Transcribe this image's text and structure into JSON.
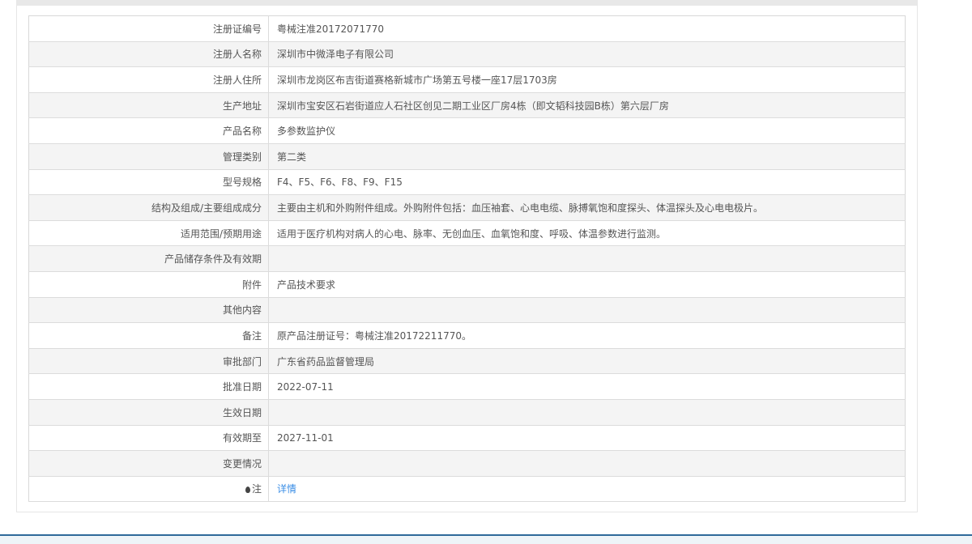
{
  "rows": [
    {
      "label": "注册证编号",
      "value": "粤械注准20172071770"
    },
    {
      "label": "注册人名称",
      "value": "深圳市中微泽电子有限公司"
    },
    {
      "label": "注册人住所",
      "value": "深圳市龙岗区布吉街道赛格新城市广场第五号楼一座17层1703房"
    },
    {
      "label": "生产地址",
      "value": "深圳市宝安区石岩街道应人石社区创见二期工业区厂房4栋（即文韬科技园B栋）第六层厂房"
    },
    {
      "label": "产品名称",
      "value": "多参数监护仪"
    },
    {
      "label": "管理类别",
      "value": "第二类"
    },
    {
      "label": "型号规格",
      "value": "F4、F5、F6、F8、F9、F15"
    },
    {
      "label": "结构及组成/主要组成成分",
      "value": "主要由主机和外购附件组成。外购附件包括：血压袖套、心电电缆、脉搏氧饱和度探头、体温探头及心电电极片。"
    },
    {
      "label": "适用范围/预期用途",
      "value": "适用于医疗机构对病人的心电、脉率、无创血压、血氧饱和度、呼吸、体温参数进行监测。"
    },
    {
      "label": "产品储存条件及有效期",
      "value": ""
    },
    {
      "label": "附件",
      "value": "产品技术要求"
    },
    {
      "label": "其他内容",
      "value": ""
    },
    {
      "label": "备注",
      "value": "原产品注册证号：粤械注准20172211770。"
    },
    {
      "label": "审批部门",
      "value": "广东省药品监督管理局"
    },
    {
      "label": "批准日期",
      "value": "2022-07-11"
    },
    {
      "label": "生效日期",
      "value": ""
    },
    {
      "label": "有效期至",
      "value": "2027-11-01"
    },
    {
      "label": "变更情况",
      "value": ""
    }
  ],
  "note": {
    "label": "注",
    "link": "详情",
    "icon": "pin-icon"
  }
}
